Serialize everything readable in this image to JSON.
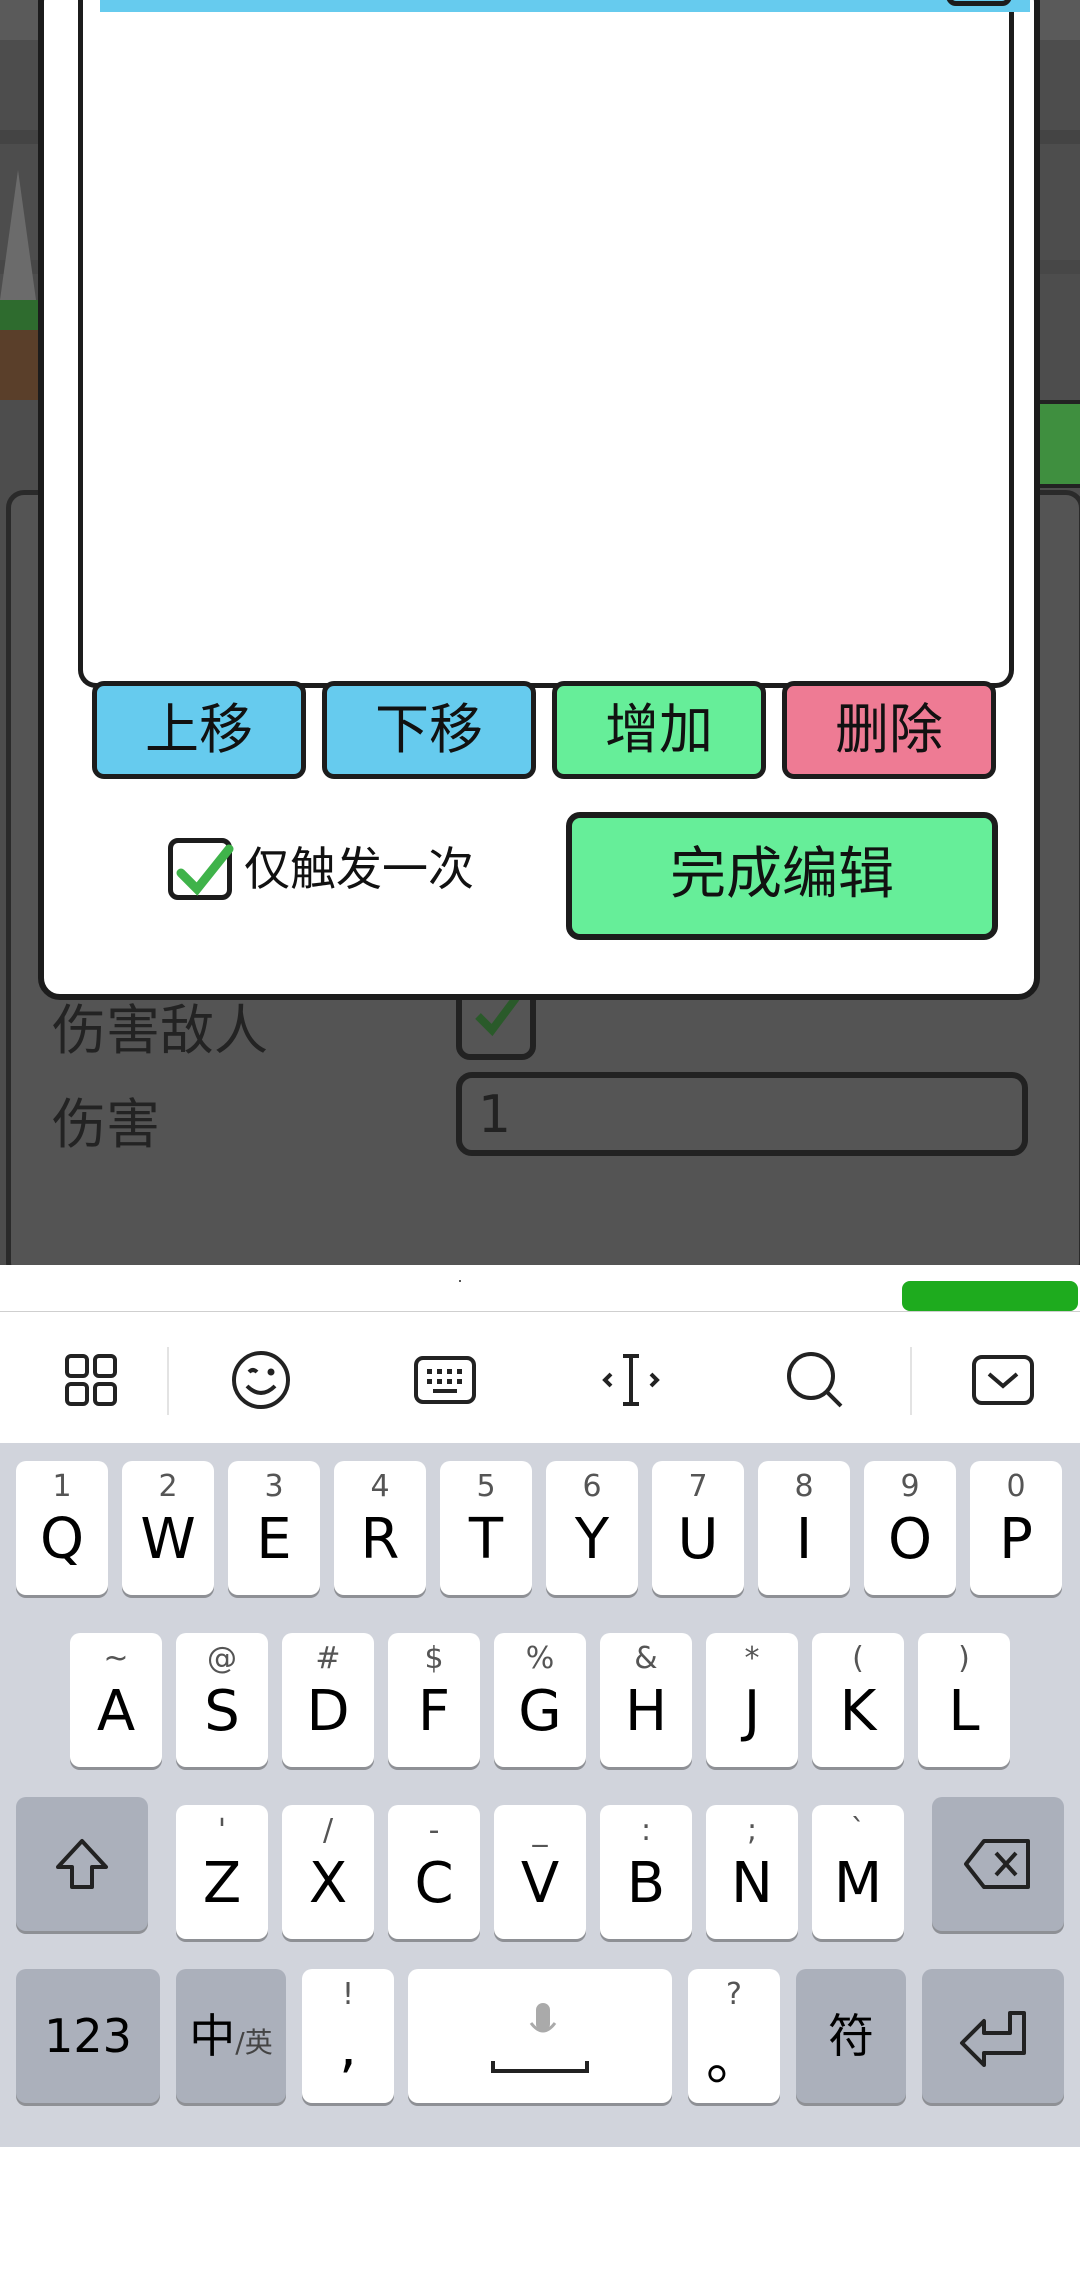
{
  "properties": {
    "damage_enemy_label": "伤害敌人",
    "damage_label": "伤害",
    "damage_value": "1"
  },
  "dialog": {
    "buttons": {
      "move_up": "上移",
      "move_down": "下移",
      "add": "增加",
      "delete": "删除"
    },
    "trigger_once_label": "仅触发一次",
    "trigger_once_checked": true,
    "finish_edit": "完成编辑"
  },
  "keyboard": {
    "toolbar_icons": [
      "grid-icon",
      "emoji-icon",
      "keyboard-icon",
      "cursor-icon",
      "search-icon",
      "hide-keyboard-icon"
    ],
    "row1": [
      {
        "sub": "1",
        "main": "Q"
      },
      {
        "sub": "2",
        "main": "W"
      },
      {
        "sub": "3",
        "main": "E"
      },
      {
        "sub": "4",
        "main": "R"
      },
      {
        "sub": "5",
        "main": "T"
      },
      {
        "sub": "6",
        "main": "Y"
      },
      {
        "sub": "7",
        "main": "U"
      },
      {
        "sub": "8",
        "main": "I"
      },
      {
        "sub": "9",
        "main": "O"
      },
      {
        "sub": "0",
        "main": "P"
      }
    ],
    "row2": [
      {
        "sub": "~",
        "main": "A"
      },
      {
        "sub": "@",
        "main": "S"
      },
      {
        "sub": "#",
        "main": "D"
      },
      {
        "sub": "$",
        "main": "F"
      },
      {
        "sub": "%",
        "main": "G"
      },
      {
        "sub": "&",
        "main": "H"
      },
      {
        "sub": "*",
        "main": "J"
      },
      {
        "sub": "(",
        "main": "K"
      },
      {
        "sub": ")",
        "main": "L"
      }
    ],
    "row3": [
      {
        "sub": "'",
        "main": "Z"
      },
      {
        "sub": "/",
        "main": "X"
      },
      {
        "sub": "-",
        "main": "C"
      },
      {
        "sub": "_",
        "main": "V"
      },
      {
        "sub": ":",
        "main": "B"
      },
      {
        "sub": ";",
        "main": "N"
      },
      {
        "sub": "`",
        "main": "M"
      }
    ],
    "num_key": "123",
    "lang_key_main": "中",
    "lang_key_sub": "/英",
    "comma_sub": "!",
    "comma_main": ",",
    "period_sub": "?",
    "period_main": "。",
    "symbol_key": "符"
  }
}
